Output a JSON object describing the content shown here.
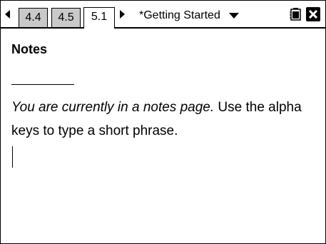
{
  "tabs": [
    {
      "label": "4.4",
      "active": false
    },
    {
      "label": "4.5",
      "active": false
    },
    {
      "label": "5.1",
      "active": true
    }
  ],
  "document_title": "*Getting Started",
  "icons": {
    "previous": "chevron-left-icon",
    "next": "chevron-right-icon",
    "dropdown": "caret-down-icon",
    "battery": "battery-icon",
    "close": "close-icon"
  },
  "notes": {
    "heading": "Notes",
    "italic_text": "You are currently in a notes page.",
    "normal_text": " Use the alpha keys to type a short phrase."
  },
  "colors": {
    "inactive_tab": "#c9c9c9",
    "active_tab": "#ffffff",
    "text": "#000000"
  }
}
